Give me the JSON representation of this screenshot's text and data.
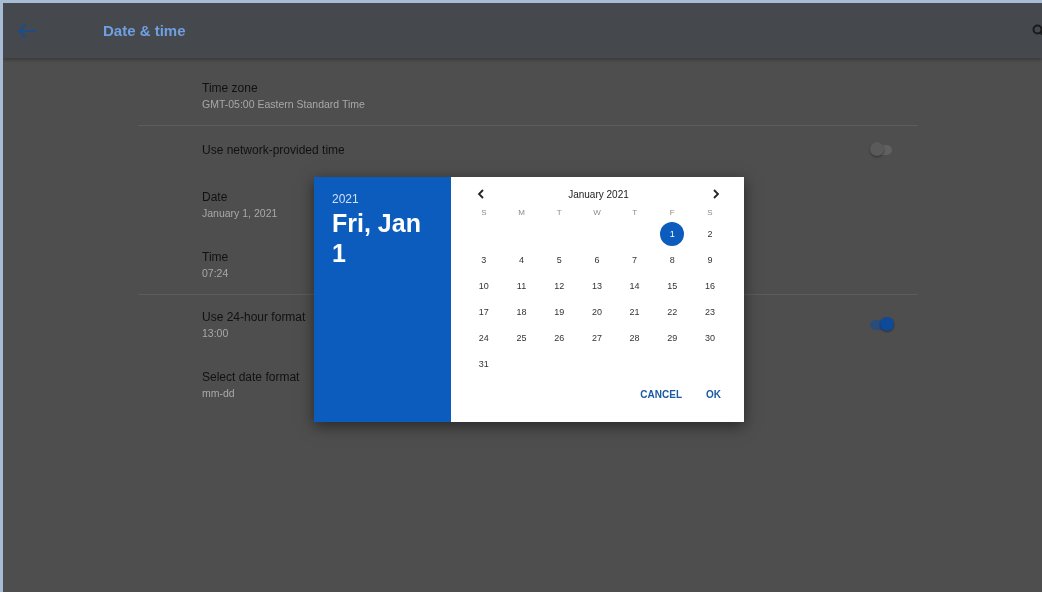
{
  "app_bar": {
    "title": "Date & time"
  },
  "settings": [
    {
      "kind": "detail",
      "title": "Time zone",
      "summary": "GMT-05:00 Eastern Standard Time",
      "divider_after": true
    },
    {
      "kind": "toggle",
      "title": "Use network-provided time",
      "on": false,
      "divider_after": false
    },
    {
      "kind": "detail",
      "title": "Date",
      "summary": "January 1, 2021",
      "divider_after": false
    },
    {
      "kind": "detail",
      "title": "Time",
      "summary": "07:24",
      "divider_after": true
    },
    {
      "kind": "toggle",
      "title": "Use 24-hour format",
      "summary": "13:00",
      "on": true,
      "divider_after": false
    },
    {
      "kind": "detail",
      "title": "Select date format",
      "summary": "mm-dd",
      "divider_after": false
    }
  ],
  "date_picker": {
    "header": {
      "year": "2021",
      "date": "Fri, Jan 1"
    },
    "calendar": {
      "month": "January 2021",
      "weekdays": [
        "S",
        "M",
        "T",
        "W",
        "T",
        "F",
        "S"
      ],
      "weeks": [
        [
          {
            "day": "1",
            "selected": true
          },
          {
            "day": "2",
            "selected": false
          }
        ],
        [
          {
            "day": "3",
            "selected": false
          },
          {
            "day": "4",
            "selected": false
          },
          {
            "day": "5",
            "selected": false
          },
          {
            "day": "6",
            "selected": false
          },
          {
            "day": "7",
            "selected": false
          },
          {
            "day": "8",
            "selected": false
          },
          {
            "day": "9",
            "selected": false
          }
        ],
        [
          {
            "day": "10",
            "selected": false
          },
          {
            "day": "11",
            "selected": false
          },
          {
            "day": "12",
            "selected": false
          },
          {
            "day": "13",
            "selected": false
          },
          {
            "day": "14",
            "selected": false
          },
          {
            "day": "15",
            "selected": false
          },
          {
            "day": "16",
            "selected": false
          }
        ],
        [
          {
            "day": "17",
            "selected": false
          },
          {
            "day": "18",
            "selected": false
          },
          {
            "day": "19",
            "selected": false
          },
          {
            "day": "20",
            "selected": false
          },
          {
            "day": "21",
            "selected": false
          },
          {
            "day": "22",
            "selected": false
          },
          {
            "day": "23",
            "selected": false
          }
        ],
        [
          {
            "day": "24",
            "selected": false
          },
          {
            "day": "25",
            "selected": false
          },
          {
            "day": "26",
            "selected": false
          },
          {
            "day": "27",
            "selected": false
          },
          {
            "day": "28",
            "selected": false
          },
          {
            "day": "29",
            "selected": false
          },
          {
            "day": "30",
            "selected": false
          }
        ],
        [
          {
            "day": "31",
            "selected": false
          }
        ]
      ]
    },
    "buttons": [
      "CANCEL",
      "OK"
    ]
  }
}
